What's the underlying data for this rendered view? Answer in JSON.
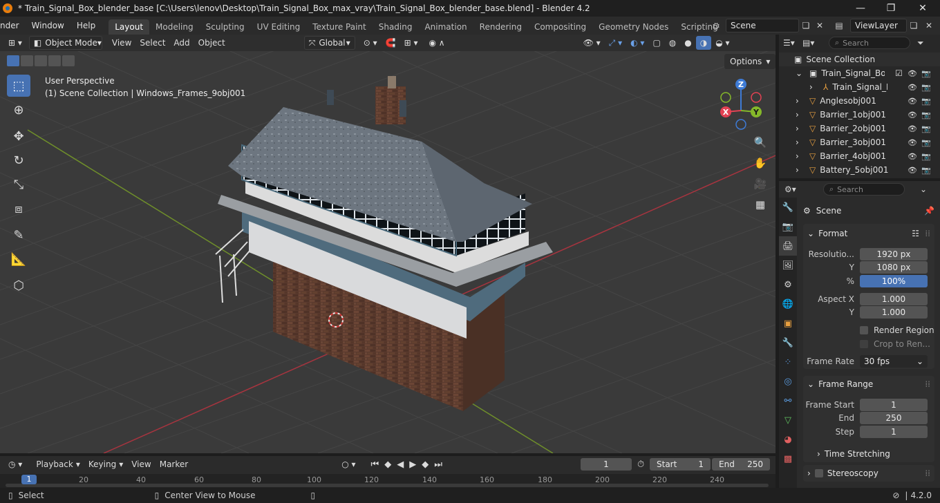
{
  "window": {
    "title": "* Train_Signal_Box_blender_base [C:\\Users\\lenov\\Desktop\\Train_Signal_Box_max_vray\\Train_Signal_Box_blender_base.blend] - Blender 4.2",
    "minimize_glyph": "—",
    "maximize_glyph": "❐",
    "close_glyph": "✕"
  },
  "menu": {
    "items": [
      "nder",
      "Window",
      "Help"
    ],
    "workspaces": [
      "Layout",
      "Modeling",
      "Sculpting",
      "UV Editing",
      "Texture Paint",
      "Shading",
      "Animation",
      "Rendering",
      "Compositing",
      "Geometry Nodes",
      "Scripting"
    ],
    "active_workspace": "Layout",
    "add_workspace": "+",
    "scene": "Scene",
    "view_layer": "ViewLayer"
  },
  "viewport": {
    "mode": "Object Mode",
    "menus": [
      "View",
      "Select",
      "Add",
      "Object"
    ],
    "transform_orientation": "Global",
    "options_label": "Options",
    "perspective_label": "User Perspective",
    "collection_label": "(1) Scene Collection | Windows_Frames_9obj001",
    "gizmo": {
      "x": "X",
      "y": "Y",
      "z": "Z"
    }
  },
  "outliner": {
    "search_placeholder": "Search",
    "root": "Scene Collection",
    "collection": "Train_Signal_Box_la",
    "child": "Train_Signal_Bo",
    "objects": [
      "Anglesobj001",
      "Barrier_1obj001",
      "Barrier_2obj001",
      "Barrier_3obj001",
      "Barrier_4obj001",
      "Battery_5obj001"
    ]
  },
  "properties": {
    "search_placeholder": "Search",
    "context": "Scene",
    "format": {
      "header": "Format",
      "resolution_label": "Resolutio...",
      "resolution_x": "1920 px",
      "y_label": "Y",
      "resolution_y": "1080 px",
      "percent_label": "%",
      "percent": "100%",
      "aspect_x_label": "Aspect X",
      "aspect_x": "1.000",
      "aspect_y_label": "Y",
      "aspect_y": "1.000",
      "render_region": "Render Region",
      "crop": "Crop to Ren...",
      "frame_rate_label": "Frame Rate",
      "frame_rate": "30 fps"
    },
    "frame_range": {
      "header": "Frame Range",
      "start_label": "Frame Start",
      "start": "1",
      "end_label": "End",
      "end": "250",
      "step_label": "Step",
      "step": "1"
    },
    "time_stretching": "Time Stretching",
    "stereoscopy": "Stereoscopy"
  },
  "timeline": {
    "menus": [
      "Playback",
      "Keying",
      "View",
      "Marker"
    ],
    "current_frame": "1",
    "start_label": "Start",
    "start": "1",
    "end_label": "End",
    "end": "250",
    "ruler": [
      "1",
      "20",
      "40",
      "60",
      "80",
      "100",
      "120",
      "140",
      "160",
      "180",
      "200",
      "220",
      "240"
    ]
  },
  "status": {
    "select": "Select",
    "center_view": "Center View to Mouse",
    "version": "4.2.0"
  },
  "colors": {
    "accent": "#4772b3",
    "x_axis": "#e24253",
    "y_axis": "#85b82a",
    "z_axis": "#3e7bd6"
  }
}
